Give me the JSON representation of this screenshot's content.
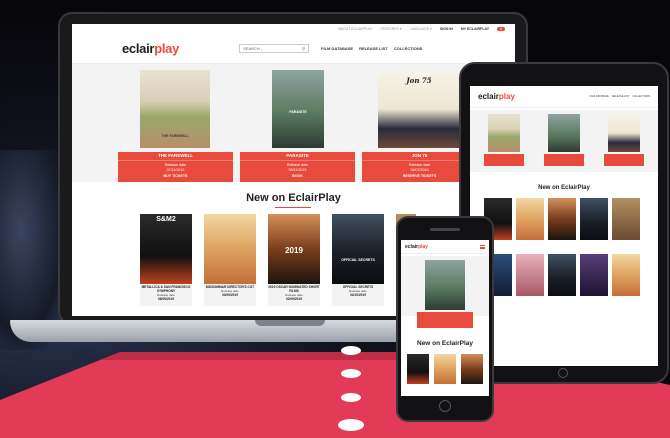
{
  "colors": {
    "accent": "#e84b3c",
    "floor": "#e23a57"
  },
  "laptop": {
    "util_links": [
      "ABOUT ECLAIRPLAY",
      "FEATURES ▾",
      "LANGUAGE ▾",
      "SIGN IN",
      "MY ECLAIRPLAY"
    ],
    "cart_badge": "0",
    "logo_main": "eclair",
    "logo_accent": "play",
    "search_placeholder": "SEARCH...",
    "nav": [
      "FILM DATABASE",
      "RELEASE LIST",
      "COLLECTIONS"
    ],
    "hero": [
      {
        "title": "THE FAREWELL",
        "line1": "Release date",
        "line2": "07/11/2019",
        "cta": "BUY TICKETS",
        "poster_text": "THE FAREWELL"
      },
      {
        "title": "PARASITE",
        "line1": "Release date",
        "line2": "05/11/2019",
        "cta": "BOOK",
        "poster_text": "PARASITE"
      },
      {
        "title": "JON 75",
        "line1": "Release date",
        "line2": "04/07/2019",
        "cta": "RESERVE TICKETS",
        "poster_text": "Jon 75"
      }
    ],
    "new_title": "New on EclairPlay",
    "new_items": [
      {
        "title": "METALLICA & SAN FRANCISCO SYMPHONY",
        "label": "Release date",
        "date": "06/09/2019",
        "poster_text": "S&M2"
      },
      {
        "title": "MIDSOMMAR DIRECTOR'S CUT",
        "label": "Release date",
        "date": "04/09/2019",
        "poster_text": ""
      },
      {
        "title": "2019 OSCAR NOMINATED SHORT FILMS",
        "label": "Release date",
        "date": "02/09/2019",
        "poster_text": "2019"
      },
      {
        "title": "OFFICIAL SECRETS",
        "label": "Release date",
        "date": "04/10/2019",
        "poster_text": "OFFICIAL SECRETS"
      },
      {
        "title": "",
        "label": "",
        "date": "",
        "poster_text": ""
      }
    ]
  },
  "tablet": {
    "logo_main": "eclair",
    "logo_accent": "play",
    "nav": [
      "FILM DATABASE",
      "RELEASE LIST",
      "COLLECTIONS"
    ],
    "new_title": "New on EclairPlay"
  },
  "phone": {
    "logo_main": "eclair",
    "logo_accent": "play",
    "dots": "• • •",
    "new_title": "New on EclairPlay"
  }
}
